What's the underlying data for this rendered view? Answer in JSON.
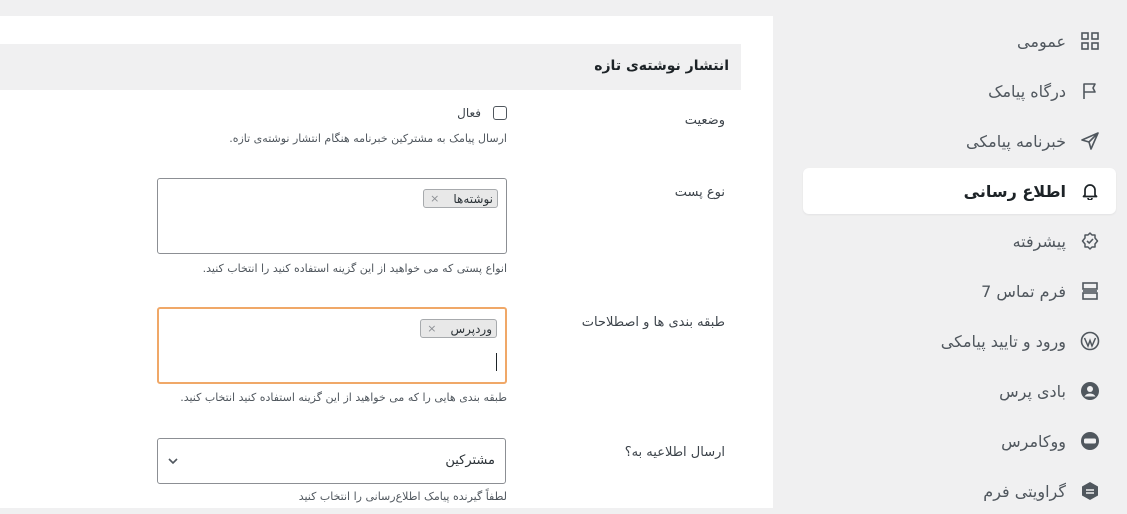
{
  "section": {
    "title": "انتشار نوشته‌ی تازه"
  },
  "fields": {
    "status": {
      "label": "وضعیت",
      "checkbox_label": "فعال",
      "description": "ارسال پیامک به مشترکین خبرنامه هنگام انتشار نوشته‌ی تازه."
    },
    "post_type": {
      "label": "نوع پست",
      "chips": [
        "نوشته‌ها"
      ],
      "description": "انواع پستی که می خواهید از این گزینه استفاده کنید را انتخاب کنید."
    },
    "taxonomy": {
      "label": "طبقه بندی ها و اصطلاحات",
      "chips": [
        "وردپرس"
      ],
      "description": "طبقه بندی هایی را که می خواهید از این گزینه استفاده کنید انتخاب کنید."
    },
    "send_to": {
      "label": "ارسال اطلاعیه به؟",
      "selected": "مشترکین",
      "description": "لطفاً گیرنده پیامک اطلاع‌رسانی را انتخاب کنید"
    }
  },
  "chip_remove": "×",
  "sidebar": {
    "active_index": 3,
    "items": [
      {
        "label": "عمومی",
        "icon": "grid-icon"
      },
      {
        "label": "درگاه پیامک",
        "icon": "flag-icon"
      },
      {
        "label": "خبرنامه پیامکی",
        "icon": "send-icon"
      },
      {
        "label": "اطلاع رسانی",
        "icon": "bell-icon"
      },
      {
        "label": "پیشرفته",
        "icon": "badge-check-icon"
      },
      {
        "label": "فرم تماس 7",
        "icon": "form-icon"
      },
      {
        "label": "ورود و تایید پیامکی",
        "icon": "wordpress-icon"
      },
      {
        "label": "بادی پرس",
        "icon": "buddypress-icon"
      },
      {
        "label": "ووکامرس",
        "icon": "woocommerce-icon"
      },
      {
        "label": "گراویتی فرم",
        "icon": "gravityforms-icon"
      }
    ]
  }
}
